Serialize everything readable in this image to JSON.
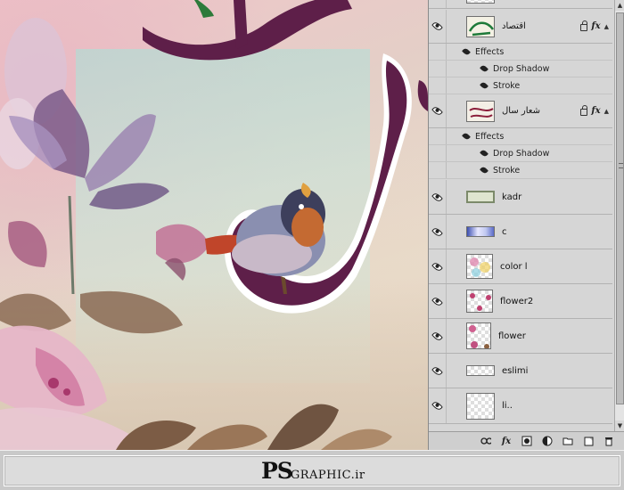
{
  "layers_panel": {
    "layers": [
      {
        "name": "اقتصاد",
        "has_lock": true,
        "has_fx": true,
        "thumb": "green-calligraphy"
      },
      {
        "name": "شعار سال",
        "has_lock": true,
        "has_fx": true,
        "thumb": "red-calligraphy"
      },
      {
        "name": "kadr",
        "thumb": "frame"
      },
      {
        "name": "c",
        "thumb": "strip"
      },
      {
        "name": "color l",
        "thumb": "colors"
      },
      {
        "name": "flower2",
        "thumb": "flower-small"
      },
      {
        "name": "flower",
        "thumb": "flower"
      },
      {
        "name": "eslimi",
        "thumb": "pattern"
      },
      {
        "name": "li..",
        "thumb": "transparent"
      }
    ],
    "effects_label": "Effects",
    "effect_items": [
      "Drop Shadow",
      "Stroke"
    ],
    "fx_text": "fx",
    "bottom_tools": [
      "link-icon",
      "fx-icon",
      "mask-icon",
      "adjustment-icon",
      "folder-icon",
      "new-layer-icon",
      "trash-icon"
    ]
  },
  "footer": {
    "brand_ps": "PS",
    "brand_rest": "GRAPHIC.ir"
  },
  "colors": {
    "calligraphy": "#5e1f49",
    "panel_bg": "#d6d6d6",
    "footer_bg": "#dcdcdc"
  }
}
